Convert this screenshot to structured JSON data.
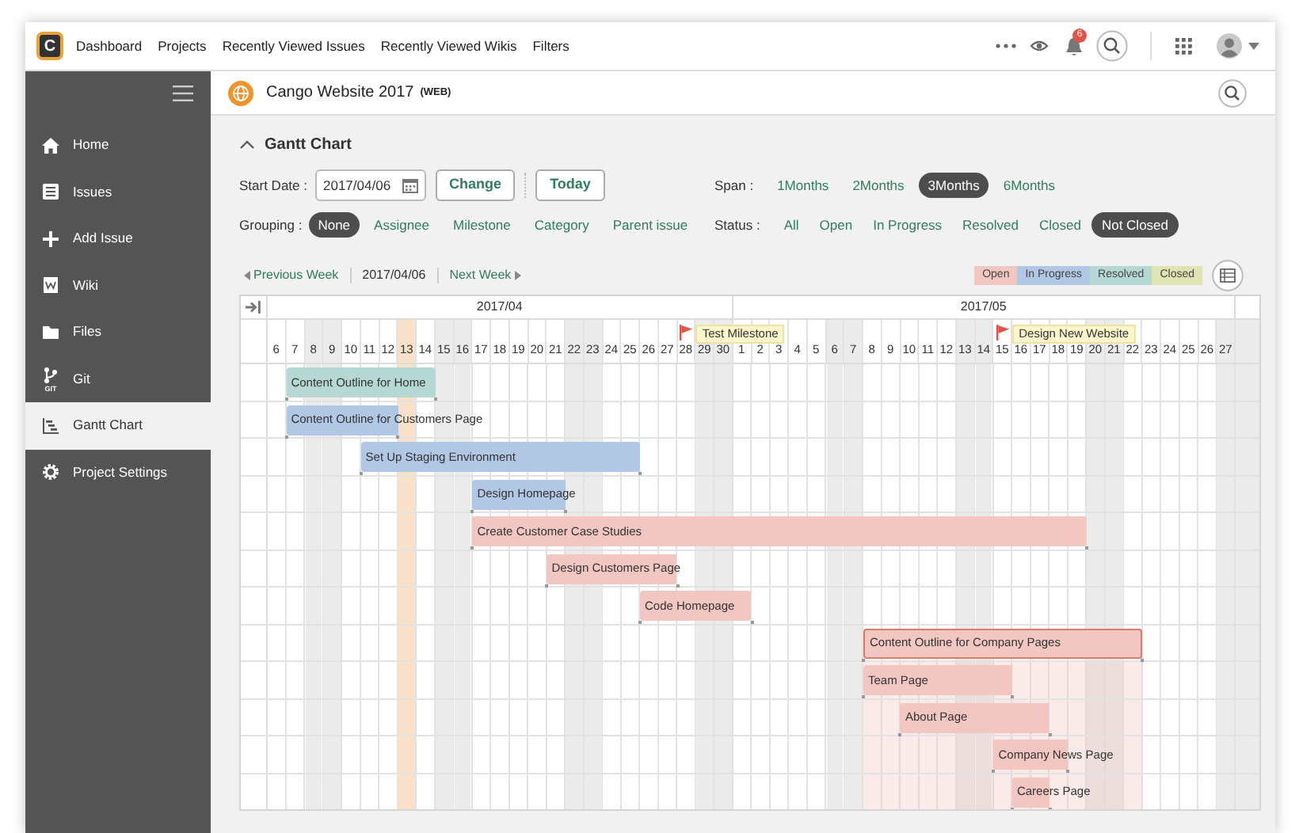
{
  "top_nav": {
    "logo": "C",
    "links": [
      "Dashboard",
      "Projects",
      "Recently Viewed Issues",
      "Recently Viewed Wikis",
      "Filters"
    ],
    "notification_count": "6"
  },
  "sidebar": {
    "items": [
      {
        "label": "Home",
        "selected": false
      },
      {
        "label": "Issues",
        "selected": false
      },
      {
        "label": "Add Issue",
        "selected": false
      },
      {
        "label": "Wiki",
        "selected": false
      },
      {
        "label": "Files",
        "selected": false
      },
      {
        "label": "Git",
        "selected": false,
        "icon_caption": "GIT"
      },
      {
        "label": "Gantt Chart",
        "selected": true
      },
      {
        "label": "Project Settings",
        "selected": false
      }
    ]
  },
  "project": {
    "title": "Cango Website 2017",
    "key": "(WEB)"
  },
  "section": {
    "title": "Gantt Chart",
    "expanded": true
  },
  "filters": {
    "start_date_label": "Start Date :",
    "start_date": {
      "value": "2017/04/06"
    },
    "change_button": "Change",
    "today_button": "Today",
    "span_label": "Span :",
    "span_options": [
      {
        "label": "1Months",
        "selected": false
      },
      {
        "label": "2Months",
        "selected": false
      },
      {
        "label": "3Months",
        "selected": true
      },
      {
        "label": "6Months",
        "selected": false
      }
    ],
    "grouping_label": "Grouping :",
    "grouping_options": [
      {
        "label": "None",
        "selected": true
      },
      {
        "label": "Assignee",
        "selected": false
      },
      {
        "label": "Milestone",
        "selected": false
      },
      {
        "label": "Category",
        "selected": false
      },
      {
        "label": "Parent issue",
        "selected": false
      }
    ],
    "status_label": "Status :",
    "status_options": [
      {
        "label": "All",
        "selected": false
      },
      {
        "label": "Open",
        "selected": false
      },
      {
        "label": "In Progress",
        "selected": false
      },
      {
        "label": "Resolved",
        "selected": false
      },
      {
        "label": "Closed",
        "selected": false
      },
      {
        "label": "Not Closed",
        "selected": true
      }
    ]
  },
  "week_nav": {
    "previous": "Previous Week",
    "current": "2017/04/06",
    "next": "Next Week"
  },
  "legend": [
    {
      "label": "Open",
      "color": "#f2c6c1"
    },
    {
      "label": "In Progress",
      "color": "#b1c8e5"
    },
    {
      "label": "Resolved",
      "color": "#b6d8d3"
    },
    {
      "label": "Closed",
      "color": "#e0e3b2"
    }
  ],
  "gantt": {
    "months": [
      {
        "label": "2017/04",
        "days": [
          {
            "label": "6",
            "weekend": false,
            "today": false
          },
          {
            "label": "7",
            "weekend": false,
            "today": false
          },
          {
            "label": "8",
            "weekend": true,
            "today": false
          },
          {
            "label": "9",
            "weekend": true,
            "today": false
          },
          {
            "label": "10",
            "weekend": false,
            "today": false
          },
          {
            "label": "11",
            "weekend": false,
            "today": false
          },
          {
            "label": "12",
            "weekend": false,
            "today": false
          },
          {
            "label": "13",
            "weekend": false,
            "today": true
          },
          {
            "label": "14",
            "weekend": false,
            "today": false
          },
          {
            "label": "15",
            "weekend": true,
            "today": false
          },
          {
            "label": "16",
            "weekend": true,
            "today": false
          },
          {
            "label": "17",
            "weekend": false,
            "today": false
          },
          {
            "label": "18",
            "weekend": false,
            "today": false
          },
          {
            "label": "19",
            "weekend": false,
            "today": false
          },
          {
            "label": "20",
            "weekend": false,
            "today": false
          },
          {
            "label": "21",
            "weekend": false,
            "today": false
          },
          {
            "label": "22",
            "weekend": true,
            "today": false
          },
          {
            "label": "23",
            "weekend": true,
            "today": false
          },
          {
            "label": "24",
            "weekend": false,
            "today": false
          },
          {
            "label": "25",
            "weekend": false,
            "today": false
          },
          {
            "label": "26",
            "weekend": false,
            "today": false
          },
          {
            "label": "27",
            "weekend": false,
            "today": false
          },
          {
            "label": "28",
            "weekend": false,
            "today": false
          },
          {
            "label": "29",
            "weekend": true,
            "today": false
          },
          {
            "label": "30",
            "weekend": true,
            "today": false
          }
        ]
      },
      {
        "label": "2017/05",
        "days": [
          {
            "label": "1",
            "weekend": false,
            "today": false
          },
          {
            "label": "2",
            "weekend": false,
            "today": false
          },
          {
            "label": "3",
            "weekend": false,
            "today": false
          },
          {
            "label": "4",
            "weekend": false,
            "today": false
          },
          {
            "label": "5",
            "weekend": false,
            "today": false
          },
          {
            "label": "6",
            "weekend": true,
            "today": false
          },
          {
            "label": "7",
            "weekend": true,
            "today": false
          },
          {
            "label": "8",
            "weekend": false,
            "today": false
          },
          {
            "label": "9",
            "weekend": false,
            "today": false
          },
          {
            "label": "10",
            "weekend": false,
            "today": false
          },
          {
            "label": "11",
            "weekend": false,
            "today": false
          },
          {
            "label": "12",
            "weekend": false,
            "today": false
          },
          {
            "label": "13",
            "weekend": true,
            "today": false
          },
          {
            "label": "14",
            "weekend": true,
            "today": false
          },
          {
            "label": "15",
            "weekend": false,
            "today": false
          },
          {
            "label": "16",
            "weekend": false,
            "today": false
          },
          {
            "label": "17",
            "weekend": false,
            "today": false
          },
          {
            "label": "18",
            "weekend": false,
            "today": false
          },
          {
            "label": "19",
            "weekend": false,
            "today": false
          },
          {
            "label": "20",
            "weekend": true,
            "today": false
          },
          {
            "label": "21",
            "weekend": true,
            "today": false
          },
          {
            "label": "22",
            "weekend": false,
            "today": false
          },
          {
            "label": "23",
            "weekend": false,
            "today": false
          },
          {
            "label": "24",
            "weekend": false,
            "today": false
          },
          {
            "label": "25",
            "weekend": false,
            "today": false
          },
          {
            "label": "26",
            "weekend": false,
            "today": false
          },
          {
            "label": "27",
            "weekend": true,
            "today": false
          }
        ]
      }
    ],
    "milestones": [
      {
        "label": "Test Milestone",
        "position": {
          "level": 0.4327
        }
      },
      {
        "label": "Design New Website",
        "position": {
          "level": 0.7596
        }
      }
    ],
    "tasks": [
      {
        "label": "Content Outline for Home",
        "color": "#b6d8d3",
        "start": {
          "level": 0.0192
        },
        "end": {
          "level": 0.1731
        }
      },
      {
        "label": "Content Outline for Customers Page",
        "color": "#b1c8e5",
        "start": {
          "level": 0.0192
        },
        "end": {
          "level": 0.1346
        }
      },
      {
        "label": "Set Up Staging Environment",
        "color": "#b1c8e5",
        "start": {
          "level": 0.0962
        },
        "end": {
          "level": 0.3846
        }
      },
      {
        "label": "Design Homepage",
        "color": "#b1c8e5",
        "start": {
          "level": 0.2115
        },
        "end": {
          "level": 0.3077
        }
      },
      {
        "label": "Create Customer Case Studies",
        "color": "#f2c6c1",
        "start": {
          "level": 0.2115
        },
        "end": {
          "level": 0.8462
        }
      },
      {
        "label": "Design Customers Page",
        "color": "#f2c6c1",
        "start": {
          "level": 0.2885
        },
        "end": {
          "level": 0.4231
        }
      },
      {
        "label": "Code Homepage",
        "color": "#f2c6c1",
        "start": {
          "level": 0.3846
        },
        "end": {
          "level": 0.5
        }
      },
      {
        "label": "Content Outline for Company Pages",
        "color": "#f2c6c1",
        "start": {
          "level": 0.6154
        },
        "end": {
          "level": 0.9038
        },
        "children": [
          {
            "label": "Team Page",
            "color": "#f2c6c1",
            "start": {
              "level": 0.6154
            },
            "end": {
              "level": 0.7692
            }
          },
          {
            "label": "About Page",
            "color": "#f2c6c1",
            "start": {
              "level": 0.6538
            },
            "end": {
              "level": 0.8077
            }
          },
          {
            "label": "Company News Page",
            "color": "#f2c6c1",
            "start": {
              "level": 0.75
            },
            "end": {
              "level": 0.8269
            }
          },
          {
            "label": "Careers Page",
            "color": "#f2c6c1",
            "start": {
              "level": 0.7692
            },
            "end": {
              "level": 0.8077
            }
          }
        ]
      }
    ]
  }
}
